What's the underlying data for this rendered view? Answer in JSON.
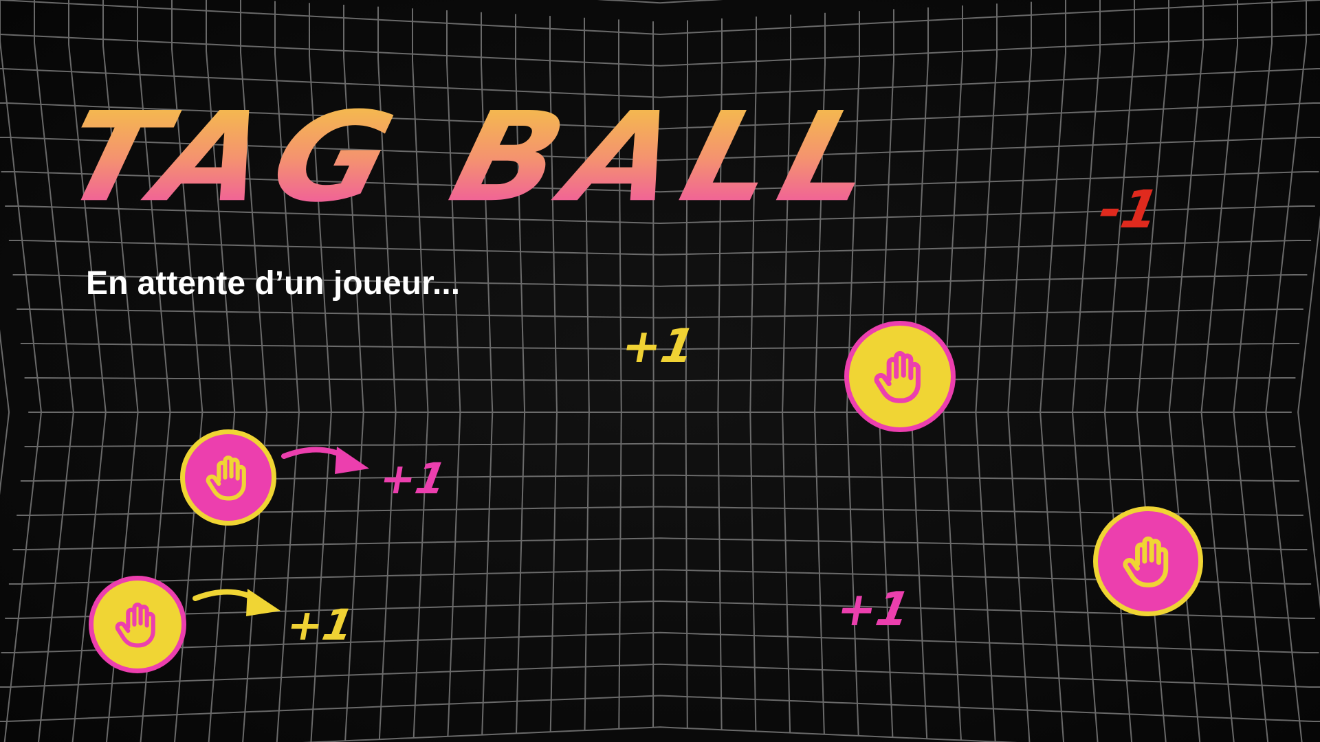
{
  "game": {
    "title": "TAG BALL",
    "status_text": "En attente d’un joueur..."
  },
  "score_popups": [
    {
      "label": "-1",
      "color": "red"
    },
    {
      "label": "+1",
      "color": "yellow"
    },
    {
      "label": "+1",
      "color": "pink"
    },
    {
      "label": "+1",
      "color": "yellow"
    },
    {
      "label": "+1",
      "color": "pink"
    }
  ],
  "tokens": [
    {
      "icon": "hand-icon",
      "style": "yellow-with-pink-border"
    },
    {
      "icon": "hand-icon",
      "style": "pink-with-yellow-border"
    },
    {
      "icon": "hand-icon",
      "style": "yellow-with-pink-border"
    },
    {
      "icon": "hand-icon",
      "style": "pink-with-yellow-border"
    }
  ],
  "colors": {
    "background": "#0b0b0b",
    "grid": "#8a8a8a",
    "yellow": "#f0d534",
    "pink": "#ec3fae",
    "red": "#e02a1e",
    "title_gradient": [
      "#f4c247",
      "#f4936f",
      "#ef4fa7"
    ]
  }
}
